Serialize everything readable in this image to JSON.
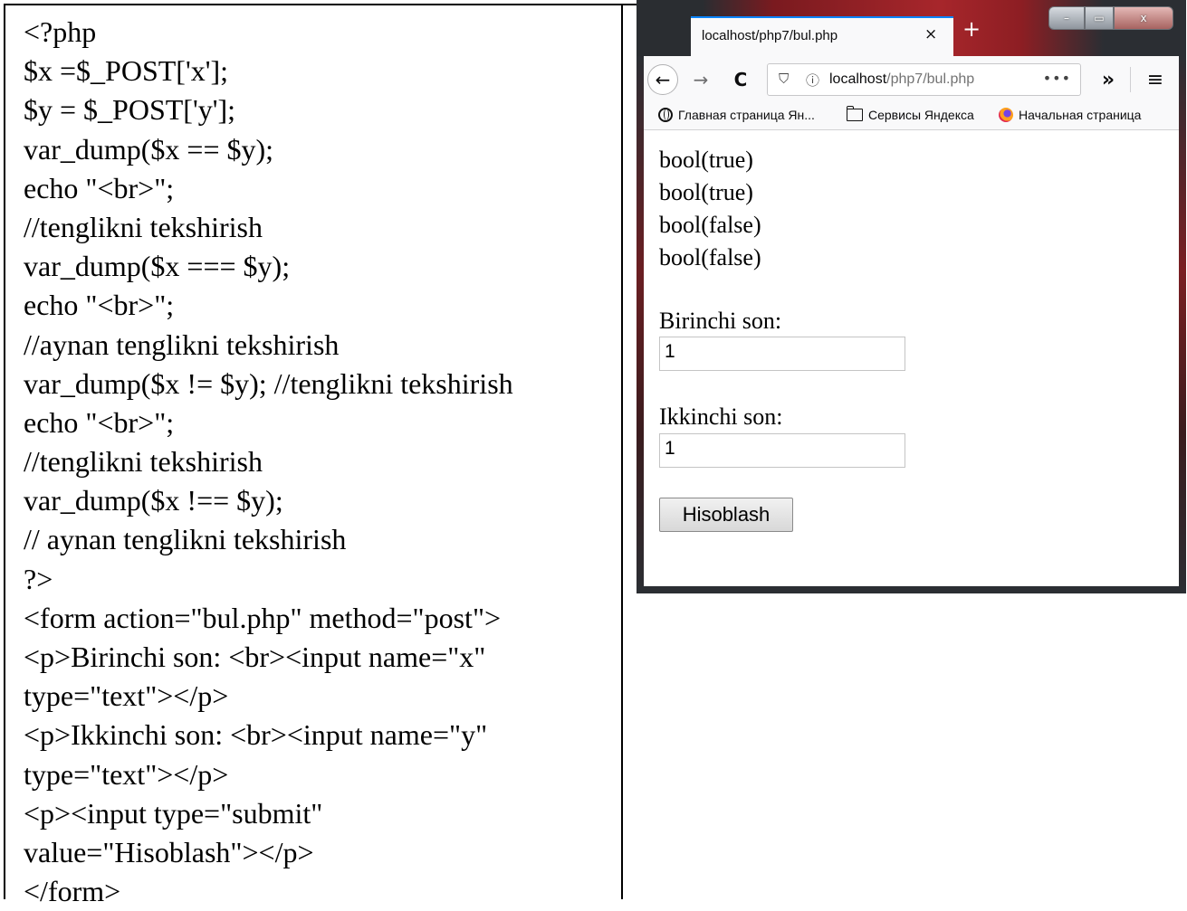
{
  "code_lines": [
    "<?php",
    "$x =$_POST['x'];",
    "$y = $_POST['y'];",
    "var_dump($x == $y);",
    "echo \"<br>\";",
    "//tenglikni tekshirish",
    "var_dump($x === $y);",
    "echo \"<br>\";",
    "//aynan tenglikni tekshirish",
    "var_dump($x != $y); //tenglikni tekshirish",
    "echo \"<br>\";",
    "//tenglikni tekshirish",
    "var_dump($x !== $y);",
    "// aynan tenglikni tekshirish",
    "?>",
    "<form action=\"bul.php\" method=\"post\">",
    "<p>Birinchi son: <br><input name=\"x\"",
    "type=\"text\"></p>",
    "<p>Ikkinchi son: <br><input name=\"y\"",
    "type=\"text\"></p>",
    "<p><input type=\"submit\"",
    "value=\"Hisoblash\"></p>",
    "</form>"
  ],
  "browser": {
    "tab_title": "localhost/php7/bul.php",
    "tab_close": "×",
    "new_tab": "+",
    "window_controls": {
      "minimize": "–",
      "maximize": "▭",
      "close": "x"
    },
    "nav": {
      "back_icon": "←",
      "forward_icon": "→",
      "reload_icon": "C",
      "shield_icon": "⛉",
      "info_icon": "ⓘ",
      "url_host": "localhost",
      "url_path": "/php7/bul.php",
      "page_actions": "•••",
      "overflow_icon": "»",
      "menu_icon": "≡"
    },
    "bookmarks": [
      {
        "label": "Главная страница Ян...",
        "icon": "globe-icon"
      },
      {
        "label": "Сервисы Яндекса",
        "icon": "folder-icon"
      },
      {
        "label": "Начальная страница",
        "icon": "firefox-icon"
      }
    ],
    "output_lines": [
      "bool(true)",
      "bool(true)",
      "bool(false)",
      "bool(false)"
    ],
    "form": {
      "label_x": "Birinchi son:",
      "value_x": "1",
      "label_y": "Ikkinchi son:",
      "value_y": "1",
      "submit_label": "Hisoblash"
    }
  }
}
